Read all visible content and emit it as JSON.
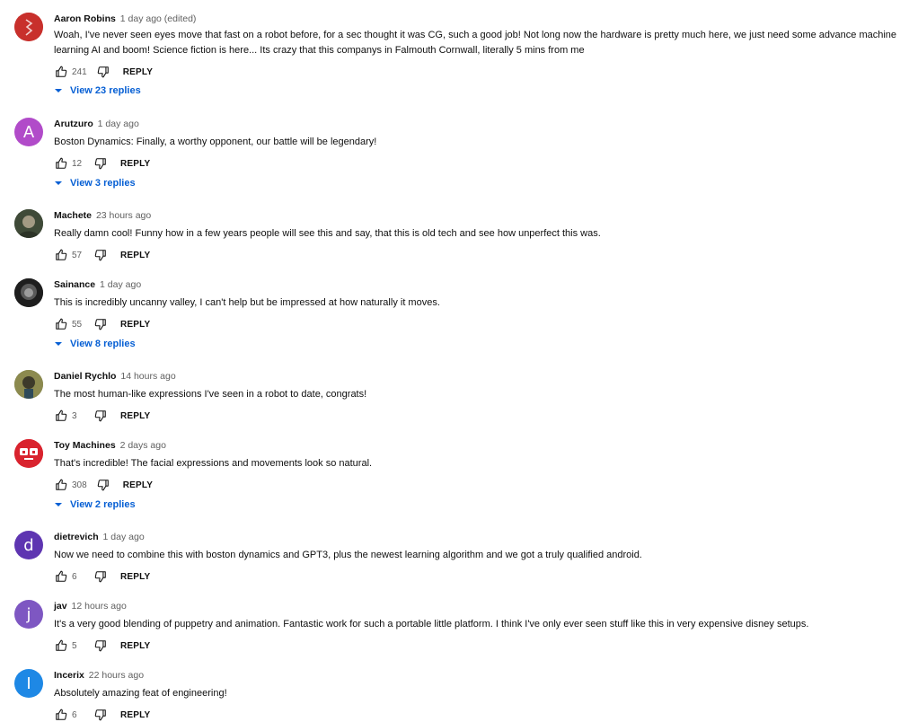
{
  "comments": [
    {
      "author": "Aaron Robins",
      "time": "1 day ago (edited)",
      "text": "Woah, I've never seen eyes move that fast on a robot before, for a sec thought it was CG, such a good job! Not long now the hardware is pretty much here, we just need some advance machine learning AI and boom! Science fiction is here... Its crazy that this companys in Falmouth Cornwall, literally 5 mins from me",
      "likes": "241",
      "reply_label": "REPLY",
      "view_replies": "View 23 replies",
      "avatar_color": "#c8302c",
      "avatar_icon": "red-emblem-avatar"
    },
    {
      "author": "Arutzuro",
      "time": "1 day ago",
      "text": "Boston Dynamics: Finally, a worthy opponent, our battle will be legendary!",
      "likes": "12",
      "reply_label": "REPLY",
      "view_replies": "View 3 replies",
      "avatar_letter": "A",
      "avatar_color": "#b14bc9"
    },
    {
      "author": "Machete",
      "time": "23 hours ago",
      "text": "Really damn cool! Funny how in a few years people will see this and say, that this is old tech and see how unperfect this was.",
      "likes": "57",
      "reply_label": "REPLY",
      "avatar_color": "#4e5a44",
      "avatar_icon": "photo-avatar"
    },
    {
      "author": "Sainance",
      "time": "1 day ago",
      "text": "This is incredibly uncanny valley, I can't help but be impressed at how naturally it moves.",
      "likes": "55",
      "reply_label": "REPLY",
      "view_replies": "View 8 replies",
      "avatar_color": "#2a2a2a",
      "avatar_icon": "photo-avatar"
    },
    {
      "author": "Daniel Rychlo",
      "time": "14 hours ago",
      "text": "The most human-like expressions I've seen in a robot to date, congrats!",
      "likes": "3",
      "reply_label": "REPLY",
      "avatar_color": "#7c8a55",
      "avatar_icon": "photo-avatar"
    },
    {
      "author": "Toy Machines",
      "time": "2 days ago",
      "text": "That's incredible! The facial expressions and movements look so natural.",
      "likes": "308",
      "reply_label": "REPLY",
      "view_replies": "View 2 replies",
      "avatar_color": "#d9232e",
      "avatar_icon": "robot-face-avatar"
    },
    {
      "author": "dietrevich",
      "time": "1 day ago",
      "text": "Now we need to combine this with boston dynamics and GPT3, plus the newest learning algorithm and we got a truly qualified android.",
      "likes": "6",
      "reply_label": "REPLY",
      "avatar_letter": "d",
      "avatar_color": "#5e35b1"
    },
    {
      "author": "jav",
      "time": "12 hours ago",
      "text": "It's a very good blending of puppetry and animation. Fantastic work for such a portable little platform. I think I've only ever seen stuff like this in very expensive disney setups.",
      "likes": "5",
      "reply_label": "REPLY",
      "avatar_letter": "j",
      "avatar_color": "#7e57c2"
    },
    {
      "author": "Incerix",
      "time": "22 hours ago",
      "text": "Absolutely amazing feat of engineering!",
      "likes": "6",
      "reply_label": "REPLY",
      "avatar_letter": "I",
      "avatar_color": "#1e88e5"
    }
  ],
  "colors": {
    "link": "#065fd4",
    "secondary_text": "#606060",
    "primary_text": "#0f0f0f"
  }
}
